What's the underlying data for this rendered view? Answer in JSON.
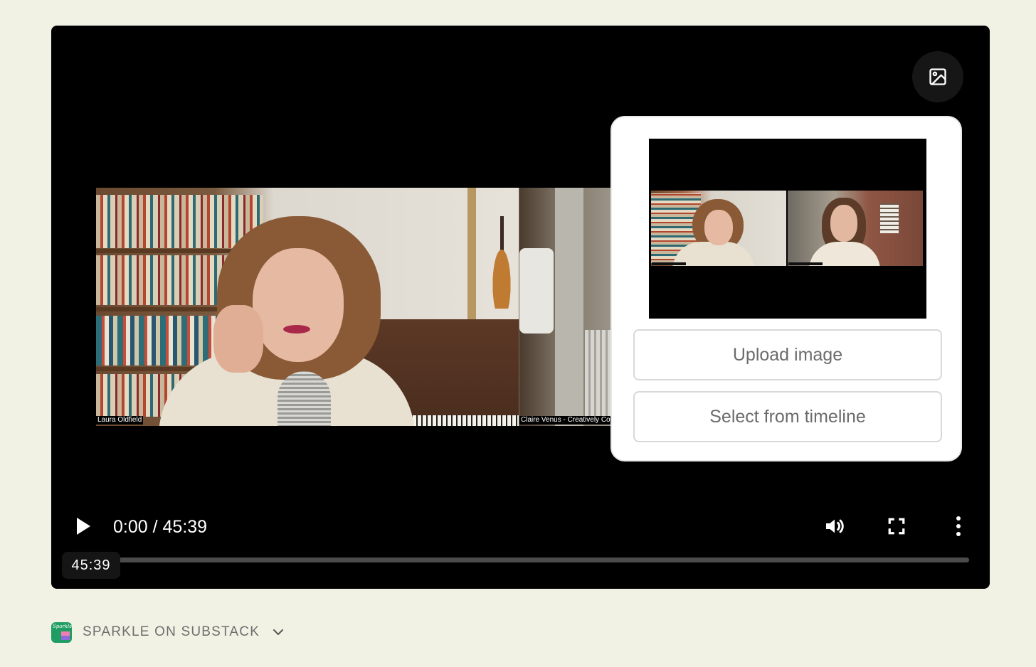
{
  "video": {
    "participants": [
      {
        "name": "Laura Oldfield"
      },
      {
        "name": "Claire Venus - Creatively Co"
      }
    ]
  },
  "thumbnail_popover": {
    "upload_label": "Upload image",
    "timeline_label": "Select from timeline"
  },
  "controls": {
    "current_time": "0:00",
    "separator": " / ",
    "duration": "45:39",
    "hover_time": "45:39",
    "progress_fraction": 0,
    "icons": [
      "play-icon",
      "volume-icon",
      "fullscreen-icon",
      "more-vertical-icon",
      "image-icon"
    ]
  },
  "footer": {
    "publication": "SPARKLE ON SUBSTACK",
    "logo_word": "Sparkle"
  },
  "colors": {
    "page_background": "#f1f1e4",
    "player_background": "#000000",
    "logo_green": "#1f9d63"
  }
}
